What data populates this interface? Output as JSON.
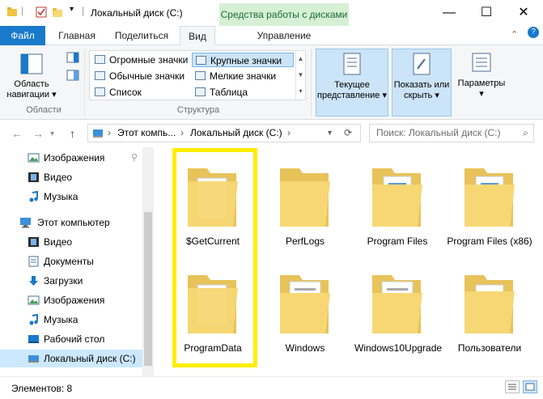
{
  "window": {
    "title": "Локальный диск (C:)",
    "context_tab_group": "Средства работы с дисками",
    "minimize": "—",
    "maximize": "☐",
    "close": "✕"
  },
  "tabs": {
    "file": "Файл",
    "home": "Главная",
    "share": "Поделиться",
    "view": "Вид",
    "manage": "Управление"
  },
  "ribbon": {
    "nav_pane_label": "Область навигации",
    "panes_group": "Области",
    "layout_group": "Структура",
    "layout_options": {
      "huge_icons": "Огромные значки",
      "large_icons": "Крупные значки",
      "normal_icons": "Обычные значки",
      "small_icons": "Мелкие значки",
      "list": "Список",
      "table": "Таблица"
    },
    "current_view": "Текущее представление",
    "show_hide": "Показать или скрыть",
    "options": "Параметры"
  },
  "address": {
    "crumb1": "Этот компь...",
    "crumb2": "Локальный диск (C:)",
    "search_placeholder": "Поиск: Локальный диск (C:)"
  },
  "nav": {
    "items": [
      {
        "label": "Изображения",
        "icon": "pictures-icon"
      },
      {
        "label": "Видео",
        "icon": "video-icon"
      },
      {
        "label": "Музыка",
        "icon": "music-icon"
      },
      {
        "label": "Этот компьютер",
        "icon": "computer-icon"
      },
      {
        "label": "Видео",
        "icon": "video-icon"
      },
      {
        "label": "Документы",
        "icon": "documents-icon"
      },
      {
        "label": "Загрузки",
        "icon": "downloads-icon"
      },
      {
        "label": "Изображения",
        "icon": "pictures-icon"
      },
      {
        "label": "Музыка",
        "icon": "music-icon"
      },
      {
        "label": "Рабочий стол",
        "icon": "desktop-icon"
      },
      {
        "label": "Локальный диск (C:)",
        "icon": "drive-icon"
      }
    ]
  },
  "folders": [
    {
      "name": "$GetCurrent"
    },
    {
      "name": "PerfLogs"
    },
    {
      "name": "Program Files"
    },
    {
      "name": "Program Files (x86)"
    },
    {
      "name": "ProgramData"
    },
    {
      "name": "Windows"
    },
    {
      "name": "Windows10Upgrade"
    },
    {
      "name": "Пользователи"
    }
  ],
  "status": {
    "item_count": "Элементов: 8"
  },
  "colors": {
    "accent": "#1979ca",
    "highlight_box": "#ffee00",
    "folder": "#f7d774",
    "selected_nav": "#cce8ff"
  }
}
